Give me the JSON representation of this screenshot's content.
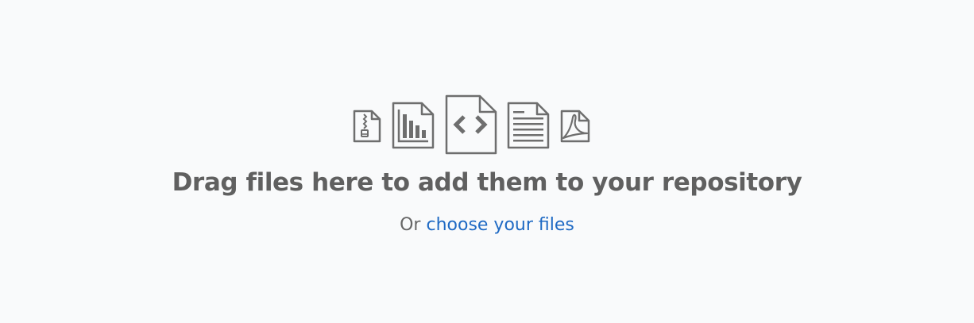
{
  "dropzone": {
    "title": "Drag files here to add them to your repository",
    "prefix": "Or",
    "link_label": "choose your files",
    "icons": [
      "file-zip-icon",
      "file-chart-icon",
      "file-code-icon",
      "file-text-icon",
      "file-pdf-icon"
    ]
  },
  "colors": {
    "background": "#f9fafb",
    "icon": "#6e6e6e",
    "title": "#606060",
    "text": "#666666",
    "link": "#1f6ac4"
  }
}
